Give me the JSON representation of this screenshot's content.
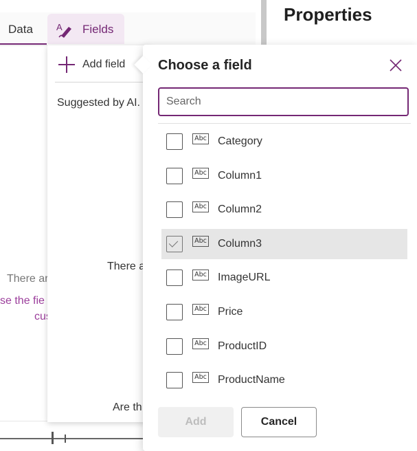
{
  "toolbar": {
    "tabs": [
      {
        "label": "Data"
      },
      {
        "label": "Fields",
        "active": true
      }
    ]
  },
  "properties_panel": {
    "title": "Properties"
  },
  "fields_pane": {
    "add_field_label": "Add field",
    "suggested_text": "Suggested by AI.",
    "empty_text_fragment": "There a",
    "question_fragment": "Are th"
  },
  "canvas": {
    "text1": "There ar",
    "text2": "se the fie",
    "text3": "cus"
  },
  "popup": {
    "title": "Choose a field",
    "search": {
      "placeholder": "Search",
      "value": ""
    },
    "fields": [
      {
        "label": "Category",
        "type_icon": "abc-text-icon",
        "checked": false
      },
      {
        "label": "Column1",
        "type_icon": "abc-text-icon",
        "checked": false
      },
      {
        "label": "Column2",
        "type_icon": "abc-text-icon",
        "checked": false
      },
      {
        "label": "Column3",
        "type_icon": "abc-text-icon",
        "checked": true
      },
      {
        "label": "ImageURL",
        "type_icon": "abc-text-icon",
        "checked": false
      },
      {
        "label": "Price",
        "type_icon": "abc-text-icon",
        "checked": false
      },
      {
        "label": "ProductID",
        "type_icon": "abc-text-icon",
        "checked": false
      },
      {
        "label": "ProductName",
        "type_icon": "abc-text-icon",
        "checked": false
      }
    ],
    "type_icon_text": "Abc",
    "add_button": {
      "label": "Add",
      "disabled": true
    },
    "cancel_button": {
      "label": "Cancel"
    }
  },
  "colors": {
    "accent": "#742774",
    "selected_row": "#e6e6e6",
    "disabled_button": "#f0f0f0"
  }
}
